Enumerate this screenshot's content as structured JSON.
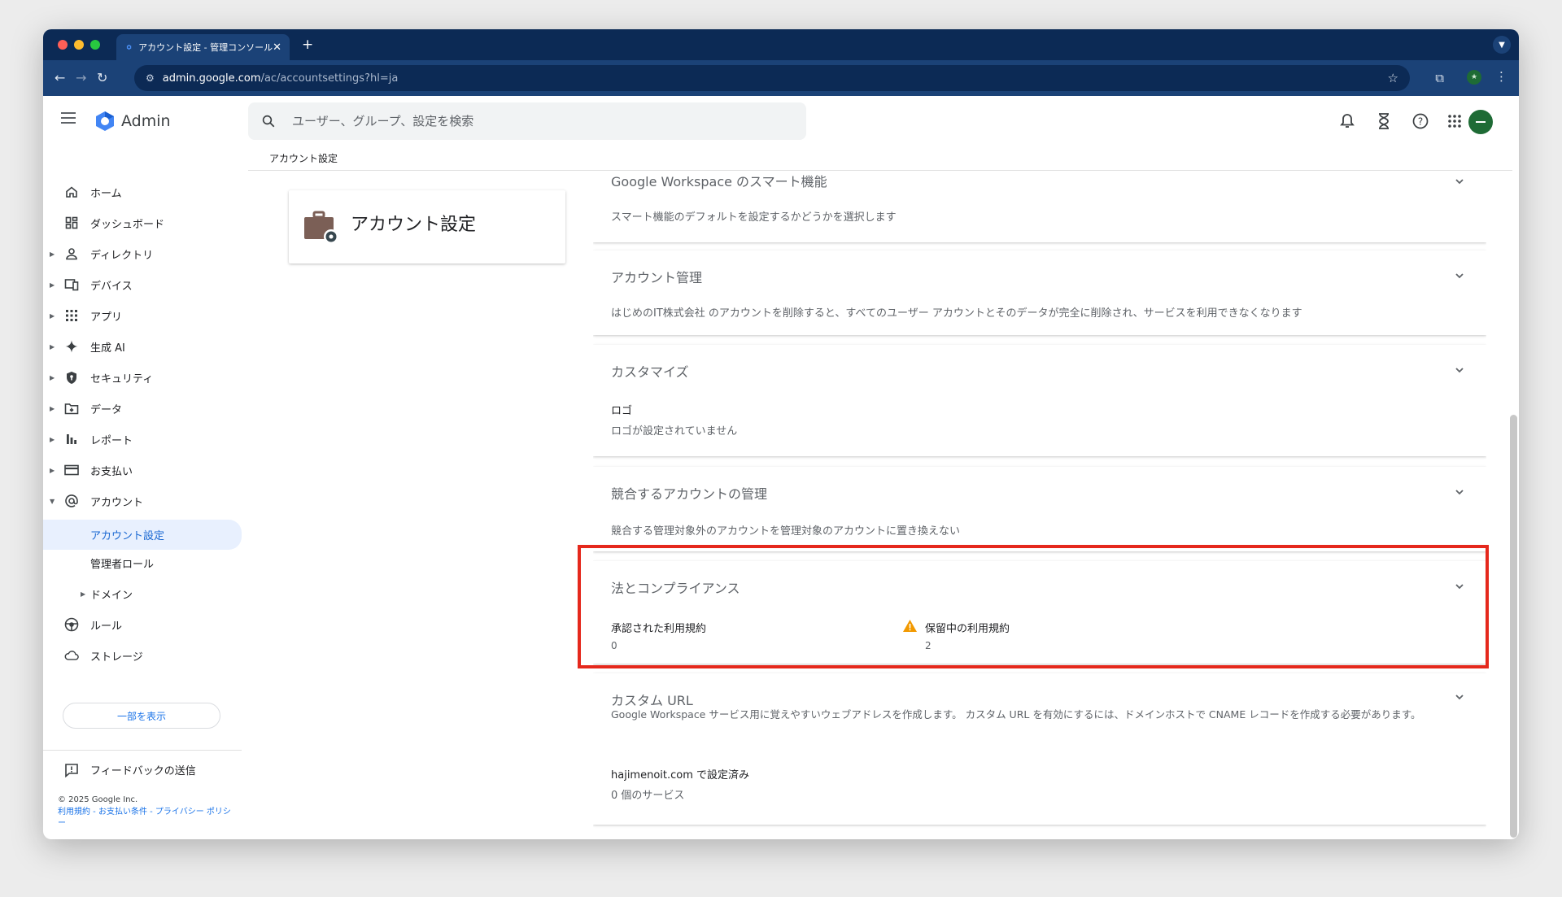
{
  "browser": {
    "tab_title": "アカウント設定 - 管理コンソール",
    "url_host": "admin.google.com",
    "url_path": "/ac/accountsettings?hl=ja"
  },
  "header": {
    "app_name": "Admin",
    "search_placeholder": "ユーザー、グループ、設定を検索"
  },
  "breadcrumb": "アカウント設定",
  "sidebar": {
    "items": [
      {
        "label": "ホーム",
        "icon": "home-icon"
      },
      {
        "label": "ダッシュボード",
        "icon": "dashboard-icon"
      },
      {
        "label": "ディレクトリ",
        "icon": "person-icon"
      },
      {
        "label": "デバイス",
        "icon": "devices-icon"
      },
      {
        "label": "アプリ",
        "icon": "apps-icon"
      },
      {
        "label": "生成 AI",
        "icon": "sparkle-icon"
      },
      {
        "label": "セキュリティ",
        "icon": "shield-icon"
      },
      {
        "label": "データ",
        "icon": "folder-icon"
      },
      {
        "label": "レポート",
        "icon": "bar-chart-icon"
      },
      {
        "label": "お支払い",
        "icon": "credit-card-icon"
      },
      {
        "label": "アカウント",
        "icon": "at-icon"
      },
      {
        "label": "アカウント設定"
      },
      {
        "label": "管理者ロール"
      },
      {
        "label": "ドメイン"
      },
      {
        "label": "ルール",
        "icon": "rules-icon"
      },
      {
        "label": "ストレージ",
        "icon": "cloud-icon"
      }
    ],
    "show_less": "一部を表示",
    "feedback": "フィードバックの送信",
    "copyright": "© 2025 Google Inc.",
    "legal": "利用規約 - お支払い条件 - プライバシー ポリシー"
  },
  "account_card": {
    "title": "アカウント設定"
  },
  "panels": {
    "smart": {
      "title": "Google Workspace のスマート機能",
      "desc": "スマート機能のデフォルトを設定するかどうかを選択します"
    },
    "account_mgmt": {
      "title": "アカウント管理",
      "desc": "はじめのIT株式会社 のアカウントを削除すると、すべてのユーザー アカウントとそのデータが完全に削除され、サービスを利用できなくなります"
    },
    "customize": {
      "title": "カスタマイズ",
      "logo_label": "ロゴ",
      "logo_value": "ロゴが設定されていません"
    },
    "conflict": {
      "title": "競合するアカウントの管理",
      "desc": "競合する管理対象外のアカウントを管理対象のアカウントに置き換えない"
    },
    "legal": {
      "title": "法とコンプライアンス",
      "accepted_label": "承認された利用規約",
      "accepted_value": "0",
      "pending_label": "保留中の利用規約",
      "pending_value": "2"
    },
    "custom_url": {
      "title": "カスタム URL",
      "desc": "Google Workspace サービス用に覚えやすいウェブアドレスを作成します。 カスタム URL を有効にするには、ドメインホストで CNAME レコードを作成する必要があります。",
      "domain_value": "hajimenoit.com で設定済み",
      "services_value": "0 個のサービス"
    }
  },
  "colors": {
    "highlight": "#e5281c",
    "accent": "#1a73e8",
    "warning": "#f29900"
  }
}
